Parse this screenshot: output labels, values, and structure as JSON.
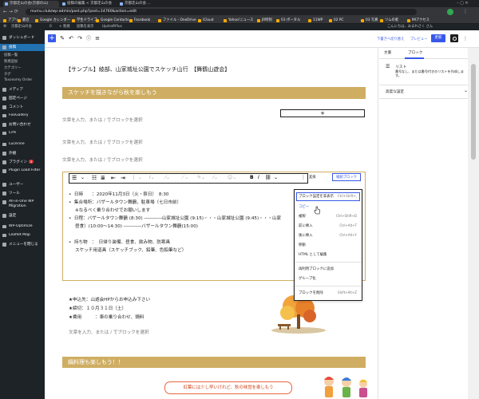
{
  "browser": {
    "tabs": [
      {
        "label": "京都走山の会(京都の山)"
      },
      {
        "label": "投稿の編集 < 京都走山の会"
      },
      {
        "label": "京都走山の会 ..."
      }
    ],
    "url": "mumu.club/wp-admin/post.php?post=14760&action=edit",
    "bookmarks": [
      "アプリ",
      "最近",
      "Google カレンダー",
      "学生ドライブ",
      "Google Contacts",
      "Facebook",
      "ファイル - OneDrive",
      "iCloud",
      "Yahoo!ニュース",
      "JR時刻",
      "01-ポータル",
      "11WP",
      "02 PC",
      "03 写真",
      "ツムの者",
      "IMアクセス"
    ]
  },
  "adminbar": {
    "items": [
      "京都走山の会",
      "0",
      "+ 新規",
      "投稿を表示",
      "UpdraftPlus"
    ],
    "greeting": "こんにちは、みまれさく さん"
  },
  "sidebar": {
    "items": [
      {
        "label": "ダッシュボード"
      },
      {
        "label": "投稿",
        "active": true
      },
      {
        "label": "投稿一覧",
        "sub": true
      },
      {
        "label": "新規追加",
        "sub": true
      },
      {
        "label": "カテゴリー",
        "sub": true
      },
      {
        "label": "タグ",
        "sub": true
      },
      {
        "label": "Taxonomy Order",
        "sub": true
      },
      {
        "label": "メディア"
      },
      {
        "label": "固定ページ"
      },
      {
        "label": "コメント"
      },
      {
        "label": "FooGallery"
      },
      {
        "label": "お問い合わせ"
      },
      {
        "label": "CPX"
      },
      {
        "label": "Lucerine"
      },
      {
        "label": "外観"
      },
      {
        "label": "プラグイン",
        "badge": "5"
      },
      {
        "label": "Plugin Load Filter"
      },
      {
        "label": "ユーザー"
      },
      {
        "label": "ツール"
      },
      {
        "label": "All-in-One WP Migration"
      },
      {
        "label": "設定"
      },
      {
        "label": "WP-Optimize"
      },
      {
        "label": "Leaflet Map"
      },
      {
        "label": "メニューを閉じる"
      }
    ]
  },
  "editor_header": {
    "save_draft": "下書きへ切り替え",
    "preview": "プレビュー",
    "update": "更新"
  },
  "panel": {
    "tabs": [
      "文書",
      "ブロック"
    ],
    "block_name": "リスト",
    "block_desc": "番号なし、または番号付きのリストを作成します。",
    "advanced": "高度な設定"
  },
  "content": {
    "title": "【サンプル】綾部、山家城址公園でスケッチ山行　【舞鶴山遊会】",
    "band1": "スケッチを描きながら秋を楽しもう",
    "placeholder": "文章を入力、または / でブロックを選択",
    "list": [
      "日時　　：2020年11月3日（火・祭日）　8:30",
      "集合場所：バザールタウン舞鶴，駐車場（七日市前）",
      "※なるべく乗り合わせでお願いします",
      "日程：バザールタウン舞鶴 (8:30) ――――山家城址公園 (9:15)・・・山家城址公園 (9:45)・・・山家",
      "昼食）(10:00～14:30) ――――バザールタウン舞鶴(15:00)",
      "持ち物　：　日帰り装備、昼食、飲み物、防寒具",
      "スケッチ用道具（スケッチブック、鉛筆、色鉛筆など）"
    ],
    "notes": [
      "★申込先：山遊会HPからお申込み下さい",
      "★締切：１０月３１日（土）",
      "★費用　　　：車の乗り合わせ、鍋料"
    ],
    "band2": "鍋料理も楽しもう！！",
    "bubble": "紅葉には少し早いけれど、秋の味覚を楽しもう",
    "list_variant_label": "変換",
    "list_variant_btn": "縦組ブロック"
  },
  "menu": {
    "items": [
      {
        "label": "ブロック設定を非表示",
        "shortcut": "Ctrl+Shift+,"
      },
      {
        "label": "コピー",
        "shortcut": ""
      },
      {
        "label": "複製",
        "shortcut": "Ctrl+Shift+D"
      },
      {
        "label": "前に挿入",
        "shortcut": "Ctrl+Alt+T"
      },
      {
        "label": "後に挿入",
        "shortcut": "Ctrl+Alt+Y"
      },
      {
        "label": "移動",
        "shortcut": ""
      },
      {
        "label": "HTML として編集",
        "shortcut": ""
      },
      {
        "label": "再利用ブロックに追加",
        "shortcut": ""
      },
      {
        "label": "グループ化",
        "shortcut": ""
      },
      {
        "label": "ブロックを削除",
        "shortcut": "Shift+Alt+Z"
      }
    ]
  }
}
